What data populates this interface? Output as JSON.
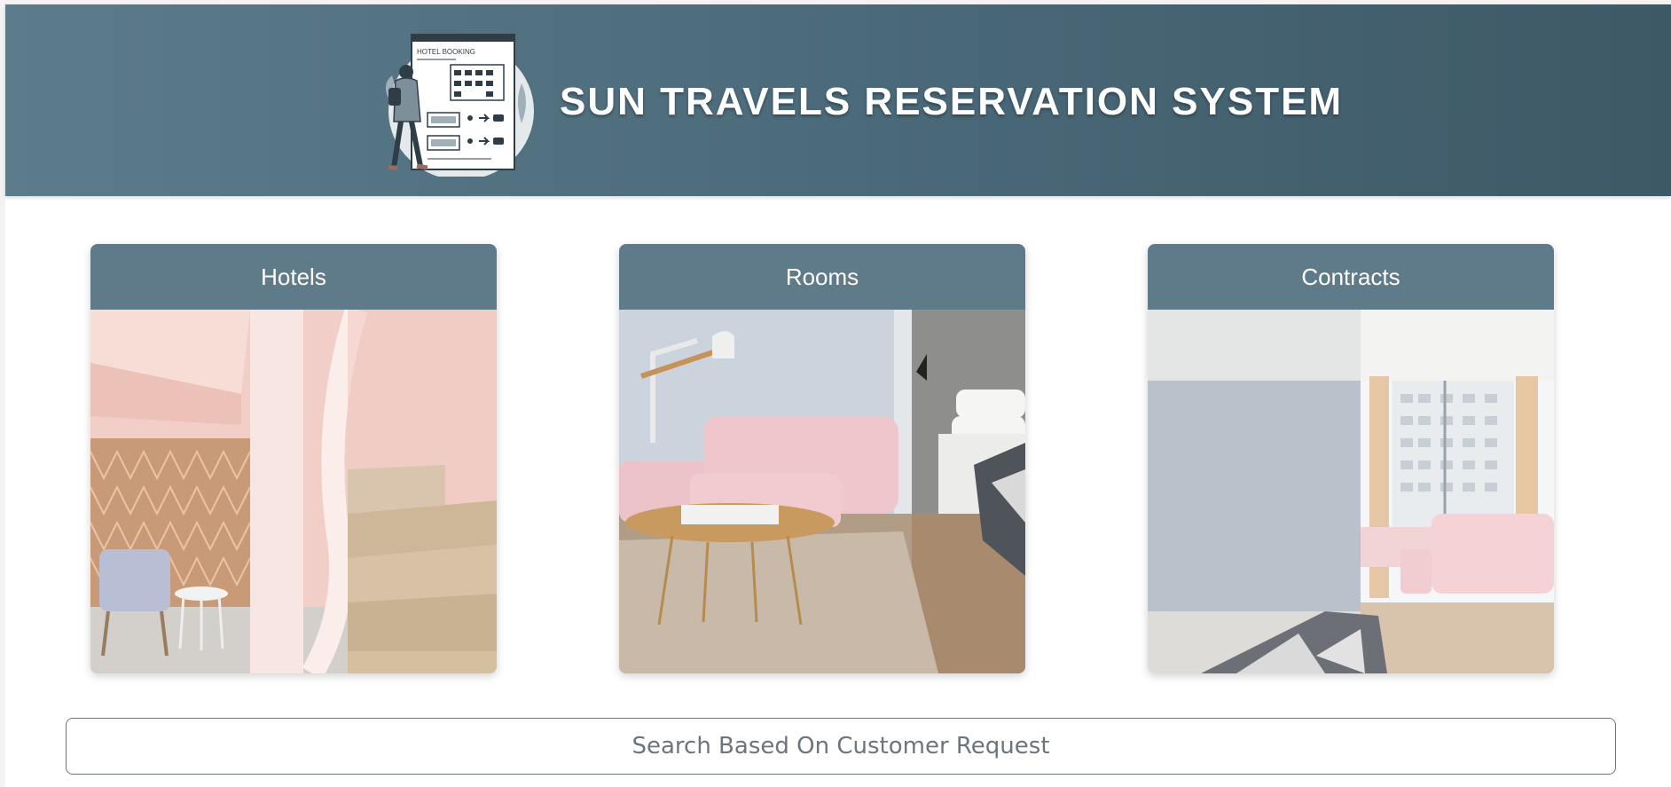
{
  "header": {
    "title": "SUN TRAVELS RESERVATION SYSTEM",
    "logo": {
      "icon": "hotel-booking-illustration",
      "text": "HOTEL BOOKING"
    }
  },
  "cards": [
    {
      "label": "Hotels",
      "image": "pink-spiral-staircase-lobby"
    },
    {
      "label": "Rooms",
      "image": "pink-sofa-living-room"
    },
    {
      "label": "Contracts",
      "image": "bright-bedroom-window"
    }
  ],
  "search_button": {
    "label": "Search Based On Customer Request"
  },
  "colors": {
    "header_gradient_start": "#5c7b8b",
    "header_gradient_end": "#3e5966",
    "card_header": "#5f7b89",
    "search_border": "#6c757d"
  }
}
